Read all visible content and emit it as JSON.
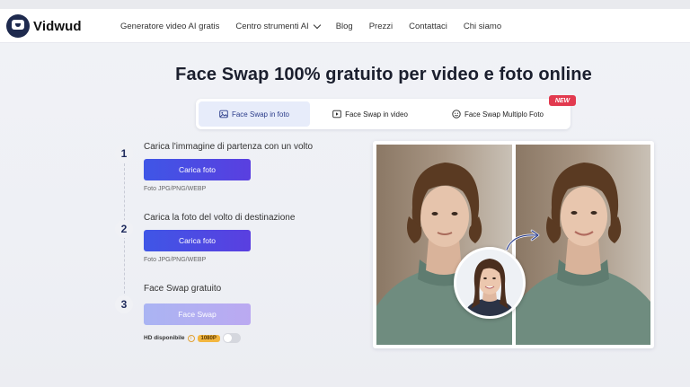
{
  "brand": {
    "name": "Vidwud"
  },
  "nav": {
    "items": [
      {
        "label": "Generatore video AI gratis"
      },
      {
        "label": "Centro strumenti AI"
      },
      {
        "label": "Blog"
      },
      {
        "label": "Prezzi"
      },
      {
        "label": "Contattaci"
      },
      {
        "label": "Chi siamo"
      }
    ]
  },
  "main": {
    "title": "Face Swap 100% gratuito per video e foto online",
    "tabs": [
      {
        "label": "Face Swap in foto",
        "icon": "image-icon",
        "active": true
      },
      {
        "label": "Face Swap in video",
        "icon": "video-icon",
        "active": false
      },
      {
        "label": "Face Swap Multiplo Foto",
        "icon": "multi-face-icon",
        "active": false
      }
    ],
    "new_badge": "NEW",
    "steps": [
      {
        "number": "1",
        "title": "Carica l'immagine di partenza con un volto",
        "button": "Carica foto",
        "hint": "Foto JPG/PNG/WEBP"
      },
      {
        "number": "2",
        "title": "Carica la foto del volto di destinazione",
        "button": "Carica foto",
        "hint": "Foto JPG/PNG/WEBP"
      },
      {
        "number": "3",
        "title": "Face Swap gratuito",
        "button": "Face Swap"
      }
    ],
    "hd": {
      "label": "HD disponibile",
      "info_icon": "info-icon",
      "resolution": "1080P",
      "enabled": false
    }
  },
  "colors": {
    "primary_button": "#4a4be4",
    "disabled_button": "#b1aff2",
    "new_badge": "#e23a4f",
    "active_tab_bg": "#e7ecfa",
    "hd_badge": "#f3b640"
  }
}
